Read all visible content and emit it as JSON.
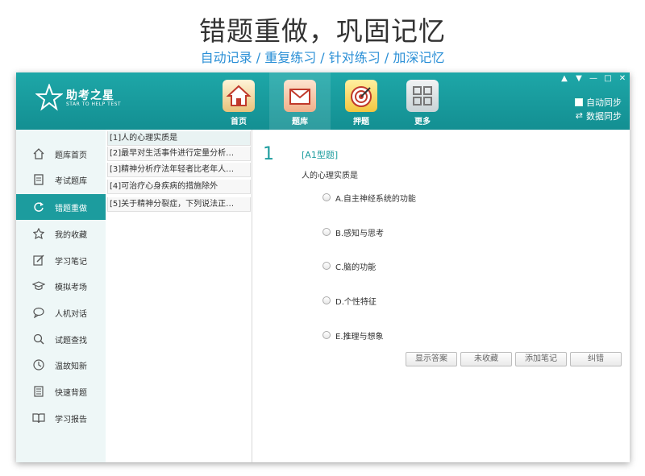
{
  "promo": {
    "title": "错题重做，巩固记忆",
    "subtitle": "自动记录 / 重复练习 / 针对练习 / 加深记忆"
  },
  "logo": {
    "name": "助考之星",
    "tagline": "STAR TO HELP TEST"
  },
  "topnav": [
    {
      "label": "首页",
      "icon": "home-icon",
      "color": "#e8c27a"
    },
    {
      "label": "题库",
      "icon": "envelope-icon",
      "color": "#f0b08a"
    },
    {
      "label": "押题",
      "icon": "target-icon",
      "color": "#f3c640"
    },
    {
      "label": "更多",
      "icon": "grid-icon",
      "color": "#c9d3d6"
    }
  ],
  "sync": {
    "auto_sync": "自动同步",
    "data_sync": "数据同步"
  },
  "sidebar": {
    "items": [
      {
        "label": "题库首页",
        "icon": "home-icon"
      },
      {
        "label": "考试题库",
        "icon": "document-icon"
      },
      {
        "label": "错题重做",
        "icon": "refresh-icon"
      },
      {
        "label": "我的收藏",
        "icon": "star-icon"
      },
      {
        "label": "学习笔记",
        "icon": "edit-icon"
      },
      {
        "label": "模拟考场",
        "icon": "graduation-icon"
      },
      {
        "label": "人机对话",
        "icon": "chat-icon"
      },
      {
        "label": "试题查找",
        "icon": "search-icon"
      },
      {
        "label": "温故知新",
        "icon": "clock-icon"
      },
      {
        "label": "快速背题",
        "icon": "list-icon"
      },
      {
        "label": "学习报告",
        "icon": "book-icon"
      }
    ]
  },
  "questions": [
    "[1]人的心理实质是",
    "[2]最早对生活事件进行定量分析…",
    "[3]精神分析疗法年轻者比老年人…",
    "[4]可治疗心身疾病的措施除外",
    "[5]关于精神分裂症，下列说法正…"
  ],
  "current": {
    "number": "1",
    "type": "[A1型题]",
    "text": "人的心理实质是",
    "options": [
      "A.自主神经系统的功能",
      "B.感知与思考",
      "C.脑的功能",
      "D.个性特征",
      "E.推理与想象"
    ]
  },
  "actions": {
    "show_answer": "显示答案",
    "favorite": "未收藏",
    "add_note": "添加笔记",
    "report_error": "纠错"
  },
  "colors": {
    "accent": "#1c9c9e",
    "promo_sub": "#2a8fd6"
  }
}
